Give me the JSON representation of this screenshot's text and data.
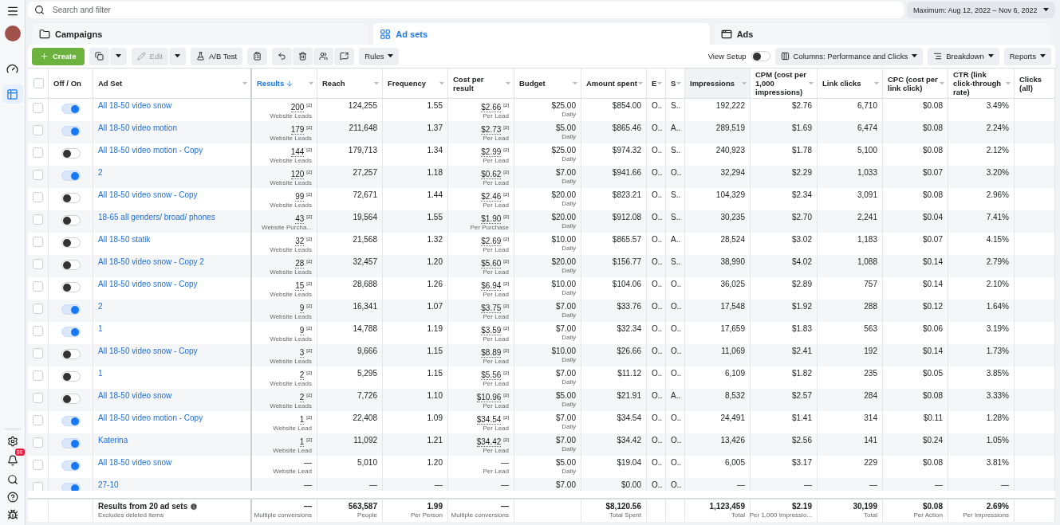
{
  "search": {
    "placeholder": "Search and filter"
  },
  "date_range": "Maximum: Aug 12, 2022 – Nov 6, 2022",
  "nav": [
    {
      "kind": "dashboard",
      "selected": false
    },
    {
      "kind": "table",
      "selected": true
    }
  ],
  "notifications_badge": "99",
  "tabs": [
    {
      "kind": "campaigns",
      "label": "Campaigns",
      "selected": false
    },
    {
      "kind": "adsets",
      "label": "Ad sets",
      "selected": true
    },
    {
      "kind": "ads",
      "label": "Ads",
      "selected": false
    }
  ],
  "toolbar": {
    "create": "Create",
    "edit": {
      "label": "Edit",
      "disabled": true
    },
    "ab_test": "A/B Test",
    "rules": "Rules",
    "view_setup": {
      "label": "View Setup",
      "on": false
    },
    "columns": "Columns: Performance and Clicks",
    "breakdown": "Breakdown",
    "reports": "Reports"
  },
  "select_all": {
    "checked": false
  },
  "columns": [
    {
      "label": "Off / On",
      "sorted": false,
      "highlighted": false
    },
    {
      "label": "Ad Set",
      "sorted": false,
      "highlighted": false
    },
    {
      "label": "Results",
      "sorted": true,
      "highlighted": false
    },
    {
      "label": "Reach",
      "sorted": false,
      "highlighted": false
    },
    {
      "label": "Frequency",
      "sorted": false,
      "highlighted": false
    },
    {
      "label": "Cost per result",
      "sorted": false,
      "highlighted": false
    },
    {
      "label": "Budget",
      "sorted": false,
      "highlighted": false
    },
    {
      "label": "Amount spent",
      "sorted": false,
      "highlighted": false
    },
    {
      "label": "E",
      "sorted": false,
      "highlighted": false
    },
    {
      "label": "S",
      "sorted": false,
      "highlighted": false
    },
    {
      "label": "Impressions",
      "sorted": false,
      "highlighted": true
    },
    {
      "label": "CPM (cost per 1,000 impressions)",
      "sorted": false,
      "highlighted": false
    },
    {
      "label": "Link clicks",
      "sorted": false,
      "highlighted": false
    },
    {
      "label": "CPC (cost per link click)",
      "sorted": false,
      "highlighted": false
    },
    {
      "label": "CTR (link click-through rate)",
      "sorted": false,
      "highlighted": false
    },
    {
      "label": "Clicks (all)",
      "sorted": false,
      "highlighted": false
    }
  ],
  "rows": [
    {
      "checked": false,
      "on": true,
      "name": "All 18-50 video snow",
      "results": {
        "value": "200",
        "note": "[2]",
        "label": "Website Leads"
      },
      "reach": "124,255",
      "frequency": "1.55",
      "cost": {
        "value": "$2.66",
        "note": "[2]",
        "label": "Per Lead"
      },
      "budget": {
        "value": "$25.00",
        "label": "Daily"
      },
      "spent": "$854.00",
      "column_9": "O..",
      "column_10": "S..",
      "impressions": "192,222",
      "cpm": "$2.76",
      "link_clicks": "6,710",
      "cpc": "$0.08",
      "ctr": "3.49%"
    },
    {
      "checked": false,
      "on": true,
      "name": "All 18-50 video motion",
      "results": {
        "value": "179",
        "note": "[2]",
        "label": "Website Leads"
      },
      "reach": "211,648",
      "frequency": "1.37",
      "cost": {
        "value": "$2.73",
        "note": "[2]",
        "label": "Per Lead"
      },
      "budget": {
        "value": "$5.00",
        "label": "Daily"
      },
      "spent": "$865.46",
      "column_9": "O..",
      "column_10": "A..",
      "impressions": "289,519",
      "cpm": "$1.69",
      "link_clicks": "6,474",
      "cpc": "$0.08",
      "ctr": "2.24%"
    },
    {
      "checked": false,
      "on": false,
      "name": "All 18-50 video motion - Copy",
      "results": {
        "value": "144",
        "note": "[2]",
        "label": "Website Leads"
      },
      "reach": "179,713",
      "frequency": "1.34",
      "cost": {
        "value": "$2.99",
        "note": "[2]",
        "label": "Per Lead"
      },
      "budget": {
        "value": "$25.00",
        "label": "Daily"
      },
      "spent": "$974.32",
      "column_9": "O..",
      "column_10": "S..",
      "impressions": "240,923",
      "cpm": "$1.78",
      "link_clicks": "5,100",
      "cpc": "$0.08",
      "ctr": "2.12%"
    },
    {
      "checked": false,
      "on": true,
      "name": "2",
      "results": {
        "value": "120",
        "note": "[2]",
        "label": "Website Leads"
      },
      "reach": "27,257",
      "frequency": "1.18",
      "cost": {
        "value": "$0.62",
        "note": "[2]",
        "label": "Per Lead"
      },
      "budget": {
        "value": "$7.00",
        "label": "Daily"
      },
      "spent": "$941.66",
      "column_9": "O..",
      "column_10": "O..",
      "impressions": "32,294",
      "cpm": "$2.29",
      "link_clicks": "1,033",
      "cpc": "$0.07",
      "ctr": "3.20%"
    },
    {
      "checked": false,
      "on": false,
      "name": "All 18-50 video snow - Copy",
      "results": {
        "value": "99",
        "note": "[2]",
        "label": "Website Leads"
      },
      "reach": "72,671",
      "frequency": "1.44",
      "cost": {
        "value": "$2.46",
        "note": "[2]",
        "label": "Per Lead"
      },
      "budget": {
        "value": "$20.00",
        "label": "Daily"
      },
      "spent": "$823.21",
      "column_9": "O..",
      "column_10": "S..",
      "impressions": "104,329",
      "cpm": "$2.34",
      "link_clicks": "3,091",
      "cpc": "$0.08",
      "ctr": "2.96%"
    },
    {
      "checked": false,
      "on": false,
      "name": "18-65 all genders/ broad/ phones",
      "results": {
        "value": "43",
        "note": "[2]",
        "label": "Website Purcha..."
      },
      "reach": "19,564",
      "frequency": "1.55",
      "cost": {
        "value": "$1.90",
        "note": "[2]",
        "label": "Per Purchase"
      },
      "budget": {
        "value": "$20.00",
        "label": "Daily"
      },
      "spent": "$912.08",
      "column_9": "O..",
      "column_10": "S..",
      "impressions": "30,235",
      "cpm": "$2.70",
      "link_clicks": "2,241",
      "cpc": "$0.04",
      "ctr": "7.41%"
    },
    {
      "checked": false,
      "on": false,
      "name": "All 18-50 statik",
      "results": {
        "value": "32",
        "note": "[2]",
        "label": "Website Leads"
      },
      "reach": "21,568",
      "frequency": "1.32",
      "cost": {
        "value": "$2.69",
        "note": "[2]",
        "label": "Per Lead"
      },
      "budget": {
        "value": "$10.00",
        "label": "Daily"
      },
      "spent": "$865.57",
      "column_9": "O..",
      "column_10": "A..",
      "impressions": "28,524",
      "cpm": "$3.02",
      "link_clicks": "1,183",
      "cpc": "$0.07",
      "ctr": "4.15%"
    },
    {
      "checked": false,
      "on": false,
      "name": "All 18-50 video snow - Copy 2",
      "results": {
        "value": "28",
        "note": "[2]",
        "label": "Website Leads"
      },
      "reach": "32,457",
      "frequency": "1.20",
      "cost": {
        "value": "$5.60",
        "note": "[2]",
        "label": "Per Lead"
      },
      "budget": {
        "value": "$20.00",
        "label": "Daily"
      },
      "spent": "$156.77",
      "column_9": "O..",
      "column_10": "S..",
      "impressions": "38,990",
      "cpm": "$4.02",
      "link_clicks": "1,088",
      "cpc": "$0.14",
      "ctr": "2.79%"
    },
    {
      "checked": false,
      "on": false,
      "name": "All 18-50 video snow - Copy",
      "results": {
        "value": "15",
        "note": "[2]",
        "label": "Website Leads"
      },
      "reach": "28,688",
      "frequency": "1.26",
      "cost": {
        "value": "$6.94",
        "note": "[2]",
        "label": "Per Lead"
      },
      "budget": {
        "value": "$10.00",
        "label": "Daily"
      },
      "spent": "$104.06",
      "column_9": "O..",
      "column_10": "O..",
      "impressions": "36,025",
      "cpm": "$2.89",
      "link_clicks": "757",
      "cpc": "$0.14",
      "ctr": "2.10%"
    },
    {
      "checked": false,
      "on": true,
      "name": "2",
      "results": {
        "value": "9",
        "note": "[2]",
        "label": "Website Leads"
      },
      "reach": "16,341",
      "frequency": "1.07",
      "cost": {
        "value": "$3.75",
        "note": "[2]",
        "label": "Per Lead"
      },
      "budget": {
        "value": "$7.00",
        "label": "Daily"
      },
      "spent": "$33.76",
      "column_9": "O..",
      "column_10": "O..",
      "impressions": "17,548",
      "cpm": "$1.92",
      "link_clicks": "288",
      "cpc": "$0.12",
      "ctr": "1.64%"
    },
    {
      "checked": false,
      "on": true,
      "name": "1",
      "results": {
        "value": "9",
        "note": "[2]",
        "label": "Website Leads"
      },
      "reach": "14,788",
      "frequency": "1.19",
      "cost": {
        "value": "$3.59",
        "note": "[2]",
        "label": "Per Lead"
      },
      "budget": {
        "value": "$7.00",
        "label": "Daily"
      },
      "spent": "$32.34",
      "column_9": "O..",
      "column_10": "O..",
      "impressions": "17,659",
      "cpm": "$1.83",
      "link_clicks": "563",
      "cpc": "$0.06",
      "ctr": "3.19%"
    },
    {
      "checked": false,
      "on": false,
      "name": "All 18-50 video snow - Copy",
      "results": {
        "value": "3",
        "note": "[2]",
        "label": "Website Leads"
      },
      "reach": "9,666",
      "frequency": "1.15",
      "cost": {
        "value": "$8.89",
        "note": "[2]",
        "label": "Per Lead"
      },
      "budget": {
        "value": "$10.00",
        "label": "Daily"
      },
      "spent": "$26.66",
      "column_9": "O..",
      "column_10": "O..",
      "impressions": "11,069",
      "cpm": "$2.41",
      "link_clicks": "192",
      "cpc": "$0.14",
      "ctr": "1.73%"
    },
    {
      "checked": false,
      "on": false,
      "name": "1",
      "results": {
        "value": "2",
        "note": "[2]",
        "label": "Website Leads"
      },
      "reach": "5,295",
      "frequency": "1.15",
      "cost": {
        "value": "$5.56",
        "note": "[2]",
        "label": "Per Lead"
      },
      "budget": {
        "value": "$7.00",
        "label": "Daily"
      },
      "spent": "$11.12",
      "column_9": "O..",
      "column_10": "O..",
      "impressions": "6,109",
      "cpm": "$1.82",
      "link_clicks": "235",
      "cpc": "$0.05",
      "ctr": "3.85%"
    },
    {
      "checked": false,
      "on": false,
      "name": "All 18-50 video snow",
      "results": {
        "value": "2",
        "note": "[2]",
        "label": "Website Leads"
      },
      "reach": "7,726",
      "frequency": "1.10",
      "cost": {
        "value": "$10.96",
        "note": "[2]",
        "label": "Per Lead"
      },
      "budget": {
        "value": "$5.00",
        "label": "Daily"
      },
      "spent": "$21.91",
      "column_9": "O..",
      "column_10": "A..",
      "impressions": "8,532",
      "cpm": "$2.57",
      "link_clicks": "284",
      "cpc": "$0.08",
      "ctr": "3.33%"
    },
    {
      "checked": false,
      "on": true,
      "name": "All 18-50 video motion - Copy",
      "results": {
        "value": "1",
        "note": "[2]",
        "label": "Website Lead"
      },
      "reach": "22,408",
      "frequency": "1.09",
      "cost": {
        "value": "$34.54",
        "note": "[2]",
        "label": "Per Lead"
      },
      "budget": {
        "value": "$7.00",
        "label": "Daily"
      },
      "spent": "$34.54",
      "column_9": "O..",
      "column_10": "O..",
      "impressions": "24,491",
      "cpm": "$1.41",
      "link_clicks": "314",
      "cpc": "$0.11",
      "ctr": "1.28%"
    },
    {
      "checked": false,
      "on": true,
      "name": "Katerina",
      "results": {
        "value": "1",
        "note": "[2]",
        "label": "Website Lead"
      },
      "reach": "11,092",
      "frequency": "1.21",
      "cost": {
        "value": "$34.42",
        "note": "[2]",
        "label": "Per Lead"
      },
      "budget": {
        "value": "$7.00",
        "label": "Daily"
      },
      "spent": "$34.42",
      "column_9": "O..",
      "column_10": "O..",
      "impressions": "13,426",
      "cpm": "$2.56",
      "link_clicks": "141",
      "cpc": "$0.24",
      "ctr": "1.05%"
    },
    {
      "checked": false,
      "on": true,
      "name": "All 18-50 video snow",
      "results": {
        "value": "—",
        "label": "Website Lead"
      },
      "reach": "5,010",
      "frequency": "1.20",
      "cost": {
        "value": "—",
        "label": "Per Lead"
      },
      "budget": {
        "value": "$5.00",
        "label": "Daily"
      },
      "spent": "$19.04",
      "column_9": "O..",
      "column_10": "O..",
      "impressions": "6,005",
      "cpm": "$3.17",
      "link_clicks": "229",
      "cpc": "$0.08",
      "ctr": "3.81%"
    },
    {
      "checked": false,
      "on": true,
      "name": "27-10",
      "results": {
        "value": "—"
      },
      "reach": "—",
      "frequency": "—",
      "cost": {
        "value": "—"
      },
      "budget": {
        "value": "$7.00"
      },
      "spent": "$0.00",
      "column_9": "O..",
      "column_10": "O..",
      "impressions": "—",
      "cpm": "—",
      "link_clicks": "—",
      "cpc": "—",
      "ctr": "—"
    }
  ],
  "summary": {
    "title": "Results from 20 ad sets",
    "subtitle": "Excludes deleted items",
    "results": {
      "value": "—",
      "label": "Multiple conversions"
    },
    "reach": {
      "value": "563,587",
      "label": "People"
    },
    "frequency": {
      "value": "1.99",
      "label": "Per Person"
    },
    "cost": {
      "value": "—",
      "label": "Multiple conversions"
    },
    "spent": {
      "value": "$8,120.56",
      "label": "Total Spent"
    },
    "impressions": {
      "value": "1,123,459",
      "label": "Total"
    },
    "cpm": {
      "value": "$2.19",
      "label": "Per 1,000 Impressio..."
    },
    "link_clicks": {
      "value": "30,199",
      "label": "Total"
    },
    "cpc": {
      "value": "$0.08",
      "label": "Per Action"
    },
    "ctr": {
      "value": "2.69%",
      "label": "Per Impressions"
    }
  }
}
